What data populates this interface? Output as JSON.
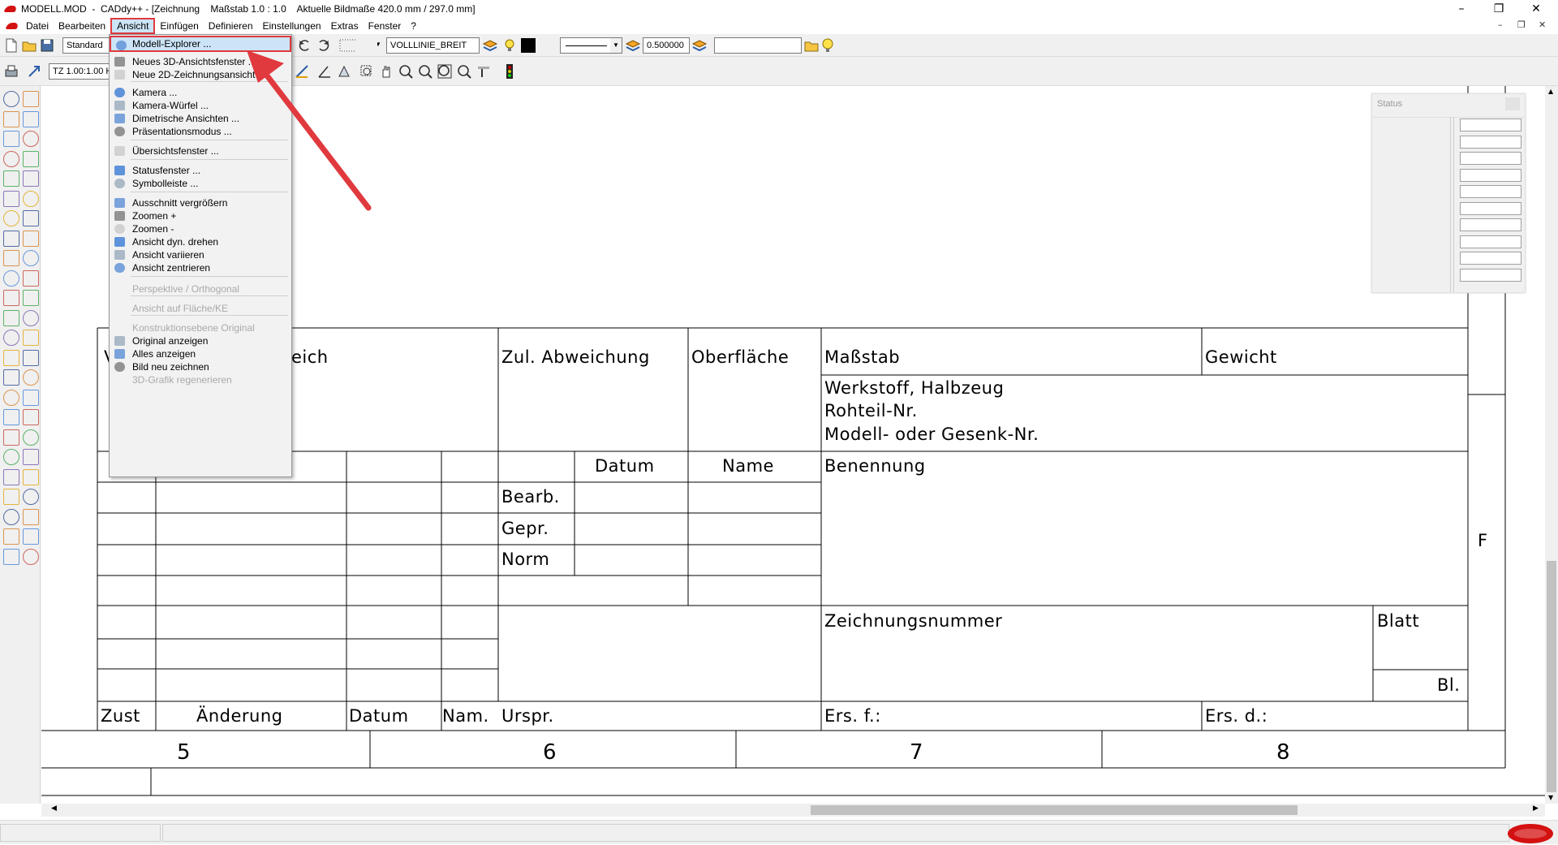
{
  "titlebar": {
    "title": "MODELL.MOD  -  CADdy++ - [Zeichnung    Maßstab 1.0 : 1.0    Aktuelle Bildmaße 420.0 mm / 297.0 mm]",
    "minimize": "–",
    "restore": "❐",
    "close": "✕"
  },
  "menubar": {
    "items": [
      "Datei",
      "Bearbeiten",
      "Ansicht",
      "Einfügen",
      "Definieren",
      "Einstellungen",
      "Extras",
      "Fenster",
      "?"
    ],
    "active": "Ansicht",
    "mdi_minimize": "–",
    "mdi_restore": "❐",
    "mdi_close": "✕"
  },
  "toolbar1": {
    "style_combo": "Standard",
    "linetype_combo": "VOLLLINIE_BREIT",
    "width_value": "0.500000",
    "text_field": ""
  },
  "toolbar2": {
    "scale_combo": "TZ 1.00:1.00 H"
  },
  "dropdown": {
    "items": [
      {
        "label": "Modell-Explorer ...",
        "enabled": true,
        "highlighted": true,
        "icon": "model-explorer-icon"
      },
      {
        "label": "Neues 3D-Ansichtsfenster ...",
        "enabled": true,
        "icon": "3d-window-icon"
      },
      {
        "label": "Neue 2D-Zeichnungsansicht ...",
        "enabled": true,
        "icon": "2d-view-icon"
      },
      {
        "label": "Kamera ...",
        "enabled": true,
        "icon": "camera-icon"
      },
      {
        "label": "Kamera-Würfel ...",
        "enabled": true,
        "icon": "camera-cube-icon"
      },
      {
        "label": "Dimetrische Ansichten ...",
        "enabled": true,
        "icon": "dimetric-icon"
      },
      {
        "label": "Präsentationsmodus ...",
        "enabled": true,
        "icon": "presentation-icon"
      },
      {
        "label": "Übersichtsfenster ...",
        "enabled": true,
        "icon": "overview-icon"
      },
      {
        "label": "Statusfenster ...",
        "enabled": true,
        "icon": "status-window-icon"
      },
      {
        "label": "Symbolleiste ...",
        "enabled": true,
        "icon": "toolbar-icon"
      },
      {
        "label": "Ausschnitt vergrößern",
        "enabled": true,
        "icon": "zoom-window-icon"
      },
      {
        "label": "Zoomen +",
        "enabled": true,
        "icon": "zoom-in-icon"
      },
      {
        "label": "Zoomen -",
        "enabled": true,
        "icon": "zoom-out-icon"
      },
      {
        "label": "Ansicht dyn. drehen",
        "enabled": true,
        "icon": "rotate-view-icon"
      },
      {
        "label": "Ansicht variieren",
        "enabled": true,
        "icon": "hand-icon"
      },
      {
        "label": "Ansicht zentrieren",
        "enabled": true,
        "icon": "center-view-icon"
      },
      {
        "label": "Perspektive / Orthogonal",
        "enabled": false
      },
      {
        "label": "Ansicht auf Fläche/KE",
        "enabled": false
      },
      {
        "label": "Konstruktionsebene Original",
        "enabled": false
      },
      {
        "label": "Original anzeigen",
        "enabled": true,
        "icon": "original-view-icon"
      },
      {
        "label": "Alles anzeigen",
        "enabled": true,
        "icon": "show-all-icon"
      },
      {
        "label": "Bild neu zeichnen",
        "enabled": true,
        "icon": "redraw-icon"
      },
      {
        "label": "3D-Grafik regenerieren",
        "enabled": false
      }
    ]
  },
  "statuswin": {
    "title": "Status"
  },
  "drawing": {
    "labels": {
      "bereich_partial": "eich",
      "v_partial": "V",
      "zul_abweichung": "Zul. Abweichung",
      "oberflaeche": "Oberfläche",
      "massstab": "Maßstab",
      "gewicht": "Gewicht",
      "werkstoff": "Werkstoff, Halbzeug",
      "rohteil": "Rohteil-Nr.",
      "modell": "Modell- oder Gesenk-Nr.",
      "datum": "Datum",
      "name": "Name",
      "benennung": "Benennung",
      "bearb": "Bearb.",
      "gepr": "Gepr.",
      "norm": "Norm",
      "zeichnungsnummer": "Zeichnungsnummer",
      "blatt": "Blatt",
      "bl": "Bl.",
      "zust": "Zust",
      "aenderung": "Änderung",
      "datum2": "Datum",
      "nam": "Nam.",
      "urspr": "Urspr.",
      "ersf": "Ers. f.:",
      "ersd": "Ers. d.:",
      "zone_f": "F"
    },
    "columns": [
      "5",
      "6",
      "7",
      "8"
    ]
  },
  "colors": {
    "accent": "#e0393e",
    "menu_highlight": "#cce4f7",
    "logo_red": "#d41111"
  }
}
